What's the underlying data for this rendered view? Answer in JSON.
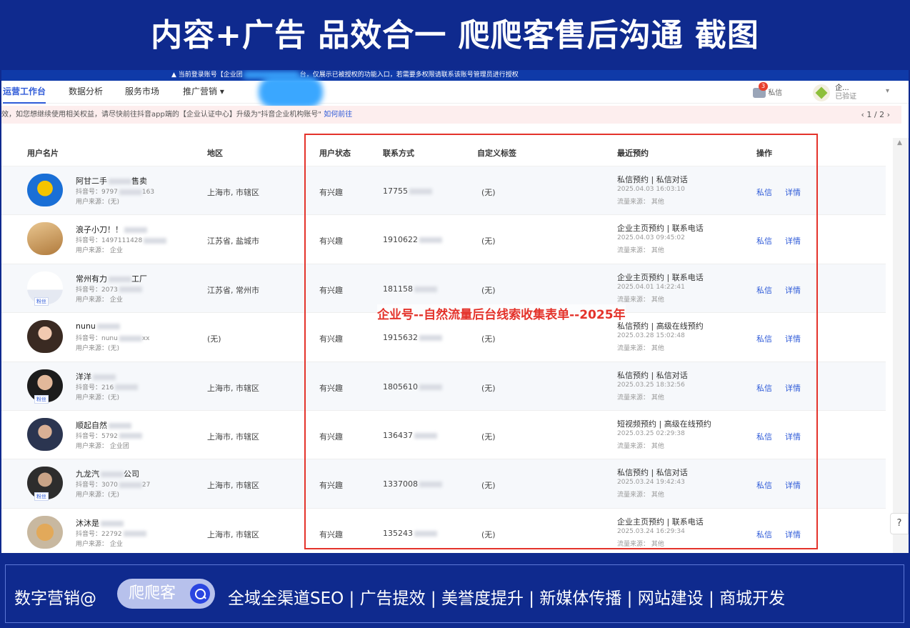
{
  "banner": {
    "title": "内容+广告 品效合一 爬爬客售后沟通 截图"
  },
  "notice": {
    "prefix": "▲ 当前登录账号【企业团",
    "suffix": "台，仅展示已被授权的功能入口，若需要多权限请联系该账号管理员进行授权"
  },
  "nav": {
    "tabs": [
      {
        "label": "运营工作台"
      },
      {
        "label": "数据分析"
      },
      {
        "label": "服务市场"
      },
      {
        "label": "推广营销 ▾"
      }
    ],
    "messages": {
      "label": "私信",
      "count": "3"
    },
    "account": {
      "name": "企...",
      "status": "已验证"
    }
  },
  "alert": {
    "text": "效，如您想继续使用相关权益，请尽快前往抖音app端的【企业认证中心】升级为\"抖音企业机构账号\"",
    "link": "如何前往",
    "pager": "‹ 1 / 2 ›"
  },
  "table": {
    "headers": {
      "user": "用户名片",
      "region": "地区",
      "status": "用户状态",
      "contact": "联系方式",
      "tag": "自定义标签",
      "appt": "最近预约",
      "ops": "操作"
    },
    "rows": [
      {
        "name": "阿甘二手",
        "name2": "售卖",
        "id": "抖音号：9797",
        "id2": "163",
        "source": "用户来源：(无)",
        "region": "上海市, 市辖区",
        "status": "有兴趣",
        "phone": "17755",
        "tag": "(无)",
        "appt": "私信预约 | 私信对话",
        "time": "2025.04.03 16:03:10",
        "flow": "流量来源：  其他",
        "op1": "私信",
        "op2": "详情",
        "fans": ""
      },
      {
        "name": "浪子小刀！！",
        "name2": "",
        "id": "抖音号：1497111428",
        "id2": "",
        "source": "用户来源：  企业",
        "region": "江苏省, 盐城市",
        "status": "有兴趣",
        "phone": "1910622",
        "tag": "(无)",
        "appt": "企业主页预约 | 联系电话",
        "time": "2025.04.03 09:45:02",
        "flow": "流量来源：  其他",
        "op1": "私信",
        "op2": "详情",
        "fans": ""
      },
      {
        "name": "常州有力",
        "name2": "工厂",
        "id": "抖音号：2073",
        "id2": "",
        "source": "用户来源：  企业",
        "region": "江苏省, 常州市",
        "status": "有兴趣",
        "phone": "181158",
        "tag": "(无)",
        "appt": "企业主页预约 | 联系电话",
        "time": "2025.04.01 14:22:41",
        "flow": "流量来源：  其他",
        "op1": "私信",
        "op2": "详情",
        "fans": "粉丝"
      },
      {
        "name": "nunu",
        "name2": "",
        "id": "抖音号：nunu",
        "id2": "xx",
        "source": "用户来源：(无)",
        "region": "(无)",
        "status": "有兴趣",
        "phone": "1915632",
        "tag": "(无)",
        "appt": "私信预约 | 高级在线预约",
        "time": "2025.03.28 15:02:48",
        "flow": "流量来源：  其他",
        "op1": "私信",
        "op2": "详情",
        "fans": ""
      },
      {
        "name": "洋洋",
        "name2": "",
        "id": "抖音号：216",
        "id2": "",
        "source": "用户来源：(无)",
        "region": "上海市, 市辖区",
        "status": "有兴趣",
        "phone": "1805610",
        "tag": "(无)",
        "appt": "私信预约 | 私信对话",
        "time": "2025.03.25 18:32:56",
        "flow": "流量来源：  其他",
        "op1": "私信",
        "op2": "详情",
        "fans": "粉丝"
      },
      {
        "name": "顺起自然",
        "name2": "",
        "id": "抖音号：5792",
        "id2": "",
        "source": "用户来源：  企业团",
        "region": "上海市, 市辖区",
        "status": "有兴趣",
        "phone": "136437",
        "tag": "(无)",
        "appt": "短视频预约 | 高级在线预约",
        "time": "2025.03.25 02:29:38",
        "flow": "流量来源：  其他",
        "op1": "私信",
        "op2": "详情",
        "fans": ""
      },
      {
        "name": "九龙汽",
        "name2": "公司",
        "id": "抖音号：3070",
        "id2": "27",
        "source": "用户来源：(无)",
        "region": "上海市, 市辖区",
        "status": "有兴趣",
        "phone": "1337008",
        "tag": "(无)",
        "appt": "私信预约 | 私信对话",
        "time": "2025.03.24 19:42:43",
        "flow": "流量来源：  其他",
        "op1": "私信",
        "op2": "详情",
        "fans": "粉丝"
      },
      {
        "name": "沐沐是",
        "name2": "",
        "id": "抖音号：22792",
        "id2": "",
        "source": "用户来源：  企业",
        "region": "上海市, 市辖区",
        "status": "有兴趣",
        "phone": "135243",
        "tag": "(无)",
        "appt": "企业主页预约 | 联系电话",
        "time": "2025.03.24 16:29:34",
        "flow": "流量来源：  其他",
        "op1": "私信",
        "op2": "详情",
        "fans": ""
      }
    ]
  },
  "overlay": {
    "label": "企业号--自然流量后台线索收集表单--2025年"
  },
  "help": {
    "label": "?"
  },
  "footer": {
    "left": "数字营销@",
    "pill": "爬爬客",
    "right": "全域全渠道SEO | 广告提效 | 美誉度提升 | 新媒体传播 | 网站建设 | 商城开发"
  },
  "colors": {
    "brand": "#0f2a8e",
    "accent": "#2f5bd8",
    "highlight": "#e4332b"
  },
  "icons": {
    "messages": "chat-bubble-icon",
    "search": "search-icon",
    "help": "question-icon",
    "caret": "chevron-down-icon"
  }
}
